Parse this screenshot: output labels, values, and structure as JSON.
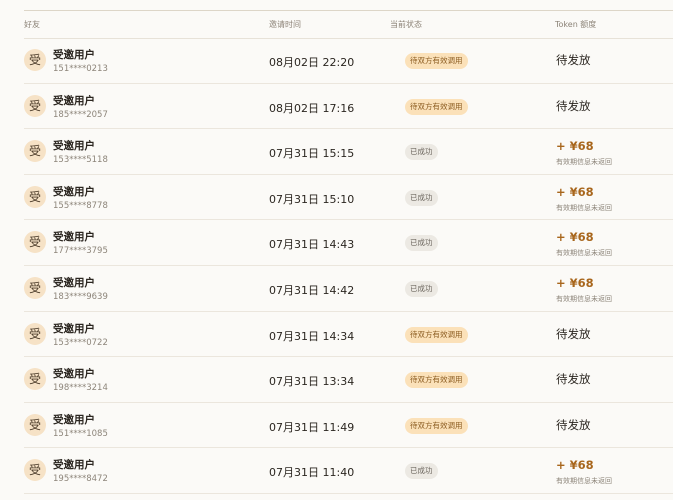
{
  "table": {
    "headers": {
      "friend": "好友",
      "invite_time": "邀请时间",
      "status": "当前状态",
      "token_quota": "Token 额度"
    },
    "rows": [
      {
        "avatar": "受",
        "name": "受邀用户",
        "phone": "151****0213",
        "time": "08月02日 22:20",
        "status": "待双方有效调用",
        "status_type": "pending",
        "token": "待发放",
        "token_note": ""
      },
      {
        "avatar": "受",
        "name": "受邀用户",
        "phone": "185****2057",
        "time": "08月02日 17:16",
        "status": "待双方有效调用",
        "status_type": "pending",
        "token": "待发放",
        "token_note": ""
      },
      {
        "avatar": "受",
        "name": "受邀用户",
        "phone": "153****5118",
        "time": "07月31日 15:15",
        "status": "已成功",
        "status_type": "success",
        "token": "+ ¥68",
        "token_note": "有效期信息未返回"
      },
      {
        "avatar": "受",
        "name": "受邀用户",
        "phone": "155****8778",
        "time": "07月31日 15:10",
        "status": "已成功",
        "status_type": "success",
        "token": "+ ¥68",
        "token_note": "有效期信息未返回"
      },
      {
        "avatar": "受",
        "name": "受邀用户",
        "phone": "177****3795",
        "time": "07月31日 14:43",
        "status": "已成功",
        "status_type": "success",
        "token": "+ ¥68",
        "token_note": "有效期信息未返回"
      },
      {
        "avatar": "受",
        "name": "受邀用户",
        "phone": "183****9639",
        "time": "07月31日 14:42",
        "status": "已成功",
        "status_type": "success",
        "token": "+ ¥68",
        "token_note": "有效期信息未返回"
      },
      {
        "avatar": "受",
        "name": "受邀用户",
        "phone": "153****0722",
        "time": "07月31日 14:34",
        "status": "待双方有效调用",
        "status_type": "pending",
        "token": "待发放",
        "token_note": ""
      },
      {
        "avatar": "受",
        "name": "受邀用户",
        "phone": "198****3214",
        "time": "07月31日 13:34",
        "status": "待双方有效调用",
        "status_type": "pending",
        "token": "待发放",
        "token_note": ""
      },
      {
        "avatar": "受",
        "name": "受邀用户",
        "phone": "151****1085",
        "time": "07月31日 11:49",
        "status": "待双方有效调用",
        "status_type": "pending",
        "token": "待发放",
        "token_note": ""
      },
      {
        "avatar": "受",
        "name": "受邀用户",
        "phone": "195****8472",
        "time": "07月31日 11:40",
        "status": "已成功",
        "status_type": "success",
        "token": "+ ¥68",
        "token_note": "有效期信息未返回"
      }
    ]
  }
}
